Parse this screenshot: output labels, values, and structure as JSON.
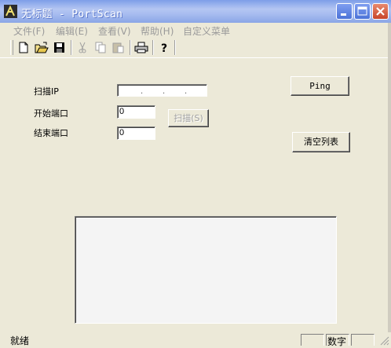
{
  "window": {
    "title": "无标题 - PortScan"
  },
  "menu": {
    "items": [
      {
        "label": "文件(F)"
      },
      {
        "label": "编辑(E)"
      },
      {
        "label": "查看(V)"
      },
      {
        "label": "帮助(H)"
      },
      {
        "label": "自定义菜单"
      }
    ]
  },
  "toolbar": {
    "buttons": [
      "new-file-icon",
      "open-folder-icon",
      "save-disk-icon",
      "cut-scissors-icon",
      "copy-icon",
      "paste-icon",
      "print-icon",
      "help-question-icon"
    ]
  },
  "form": {
    "ip_label": "扫描IP",
    "ip_dots": [
      ".",
      ".",
      "."
    ],
    "start_port_label": "开始端口",
    "start_port_value": "0",
    "end_port_label": "结束端口",
    "end_port_value": "0",
    "scan_button": "扫描(S)",
    "ping_button": "Ping",
    "clear_button": "清空列表"
  },
  "results": {
    "items": []
  },
  "status": {
    "text": "就绪",
    "pane_numlock": "数字"
  },
  "colors": {
    "titlebar_accent": "#8aa6e6",
    "window_bg": "#ece9d8"
  }
}
